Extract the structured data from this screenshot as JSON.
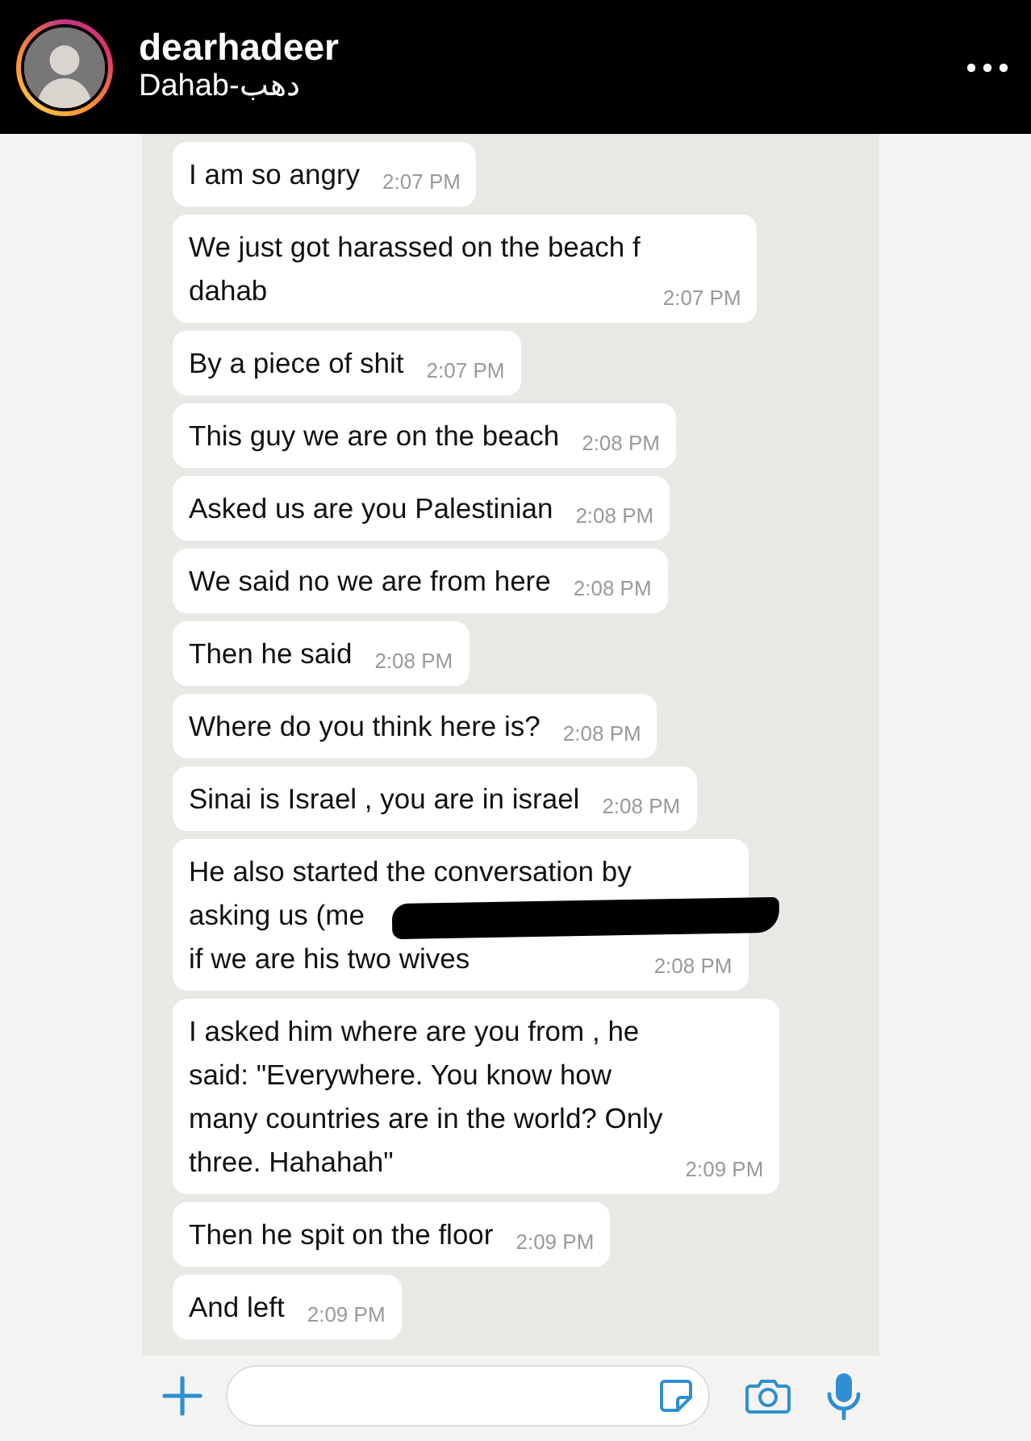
{
  "header": {
    "username": "dearhadeer",
    "location": "Dahab-دهب"
  },
  "messages": [
    {
      "lines": [
        "I am so angry"
      ],
      "time": "2:07 PM",
      "redacted": false
    },
    {
      "lines": [
        "We just got harassed on the beach f",
        "dahab"
      ],
      "time": "2:07 PM",
      "redacted": false
    },
    {
      "lines": [
        "By a piece of shit"
      ],
      "time": "2:07 PM",
      "redacted": false
    },
    {
      "lines": [
        "This guy we are on the beach"
      ],
      "time": "2:08 PM",
      "redacted": false
    },
    {
      "lines": [
        "Asked us are you Palestinian"
      ],
      "time": "2:08 PM",
      "redacted": false
    },
    {
      "lines": [
        "We said no we are from here"
      ],
      "time": "2:08 PM",
      "redacted": false
    },
    {
      "lines": [
        "Then he said"
      ],
      "time": "2:08 PM",
      "redacted": false
    },
    {
      "lines": [
        "Where do you think here is?"
      ],
      "time": "2:08 PM",
      "redacted": false
    },
    {
      "lines": [
        "Sinai is Israel , you are in israel"
      ],
      "time": "2:08 PM",
      "redacted": false
    },
    {
      "lines": [
        "He also started the conversation by",
        "asking us (me",
        "if we are his two wives"
      ],
      "time": "2:08 PM",
      "redacted": true
    },
    {
      "lines": [
        "I asked him where are you from , he",
        "said:  \"Everywhere. You know how",
        "many countries are in the world? Only",
        "three. Hahahah\""
      ],
      "time": "2:09 PM",
      "redacted": false
    },
    {
      "lines": [
        "Then he spit on the floor"
      ],
      "time": "2:09 PM",
      "redacted": false
    },
    {
      "lines": [
        "And left"
      ],
      "time": "2:09 PM",
      "redacted": false
    }
  ]
}
